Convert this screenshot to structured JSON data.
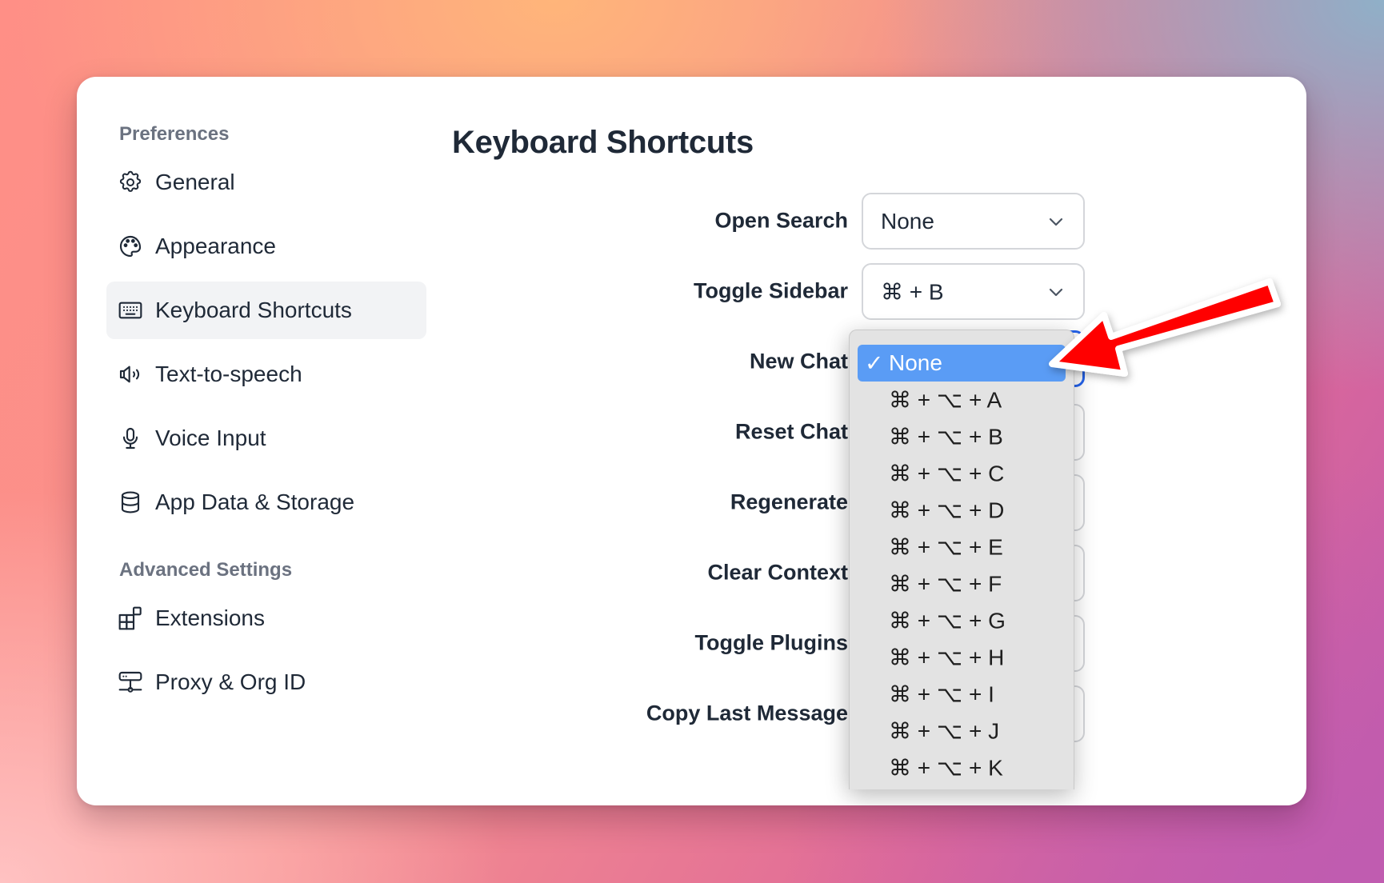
{
  "sidebar": {
    "sections": [
      {
        "title": "Preferences",
        "items": [
          {
            "label": "General",
            "icon": "gear-icon",
            "active": false
          },
          {
            "label": "Appearance",
            "icon": "palette-icon",
            "active": false
          },
          {
            "label": "Keyboard Shortcuts",
            "icon": "keyboard-icon",
            "active": true
          },
          {
            "label": "Text-to-speech",
            "icon": "speaker-icon",
            "active": false
          },
          {
            "label": "Voice Input",
            "icon": "microphone-icon",
            "active": false
          },
          {
            "label": "App Data & Storage",
            "icon": "database-icon",
            "active": false
          }
        ]
      },
      {
        "title": "Advanced Settings",
        "items": [
          {
            "label": "Extensions",
            "icon": "extensions-icon",
            "active": false
          },
          {
            "label": "Proxy & Org ID",
            "icon": "network-icon",
            "active": false
          }
        ]
      }
    ]
  },
  "main": {
    "title": "Keyboard Shortcuts",
    "shortcuts": [
      {
        "label": "Open Search",
        "value": "None"
      },
      {
        "label": "Toggle Sidebar",
        "value": "⌘ + B"
      },
      {
        "label": "New Chat",
        "value": "None",
        "focused": true
      },
      {
        "label": "Reset Chat",
        "value": ""
      },
      {
        "label": "Regenerate",
        "value": ""
      },
      {
        "label": "Clear Context",
        "value": ""
      },
      {
        "label": "Toggle Plugins",
        "value": ""
      },
      {
        "label": "Copy Last Message",
        "value": ""
      }
    ]
  },
  "dropdown": {
    "for": "New Chat",
    "check_glyph": "✓",
    "selected": "None",
    "options": [
      "None",
      "⌘ + ⌥ + A",
      "⌘ + ⌥ + B",
      "⌘ + ⌥ + C",
      "⌘ + ⌥ + D",
      "⌘ + ⌥ + E",
      "⌘ + ⌥ + F",
      "⌘ + ⌥ + G",
      "⌘ + ⌥ + H",
      "⌘ + ⌥ + I",
      "⌘ + ⌥ + J",
      "⌘ + ⌥ + K"
    ]
  },
  "annotation": {
    "arrow_color": "#ff0000",
    "points_to": "None option in New Chat dropdown"
  },
  "colors": {
    "selected_option": "#5a9cf5",
    "focus_ring": "#2563eb",
    "active_nav_bg": "#f2f3f5"
  }
}
